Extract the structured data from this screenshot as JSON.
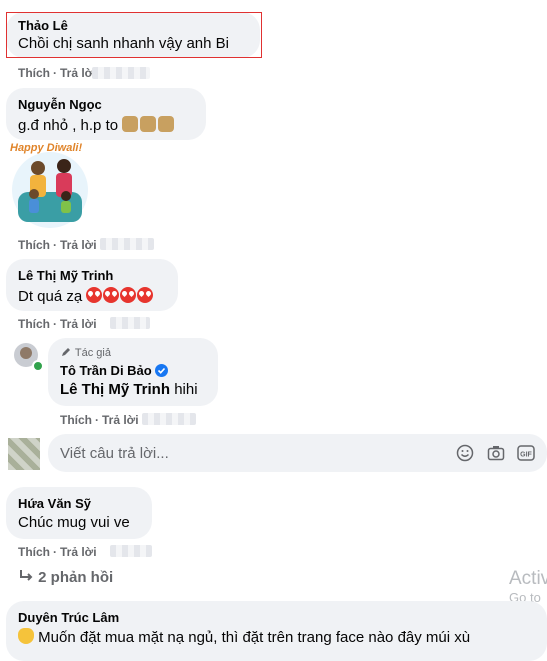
{
  "comments": [
    {
      "name": "Thảo Lê",
      "text": "Chồi chị sanh nhanh vậy anh Bi",
      "like": "Thích",
      "reply": "Trả lời"
    },
    {
      "name": "Nguyễn Ngọc",
      "text": "g.đ nhỏ , h.p to",
      "like": "Thích",
      "reply": "Trả lời",
      "sticker_text": "Happy Diwali!"
    },
    {
      "name": "Lê Thị Mỹ Trinh",
      "text": "Dt quá zạ",
      "like": "Thích",
      "reply": "Trả lời"
    },
    {
      "author_badge": "Tác giả",
      "name": "Tô Trần Di Bảo",
      "mention": "Lê Thị Mỹ Trinh",
      "text": "hihi",
      "like": "Thích",
      "reply": "Trả lời"
    },
    {
      "name": "Hứa Văn Sỹ",
      "text": "Chúc mug vui ve",
      "like": "Thích",
      "reply": "Trả lời",
      "replies_label": "2 phản hồi"
    },
    {
      "name": "Duyên Trúc Lâm",
      "text": "Muốn đặt mua mặt nạ ngủ, thì đặt trên trang face nào đây múi xù"
    }
  ],
  "reply_input": {
    "placeholder": "Viết câu trả lời..."
  },
  "overlay": {
    "line1": "Activ",
    "line2": "Go to"
  },
  "icons": [
    "smile-icon",
    "camera-icon",
    "gif-icon",
    "reply-arrow-icon",
    "pencil-icon",
    "verified-icon"
  ]
}
